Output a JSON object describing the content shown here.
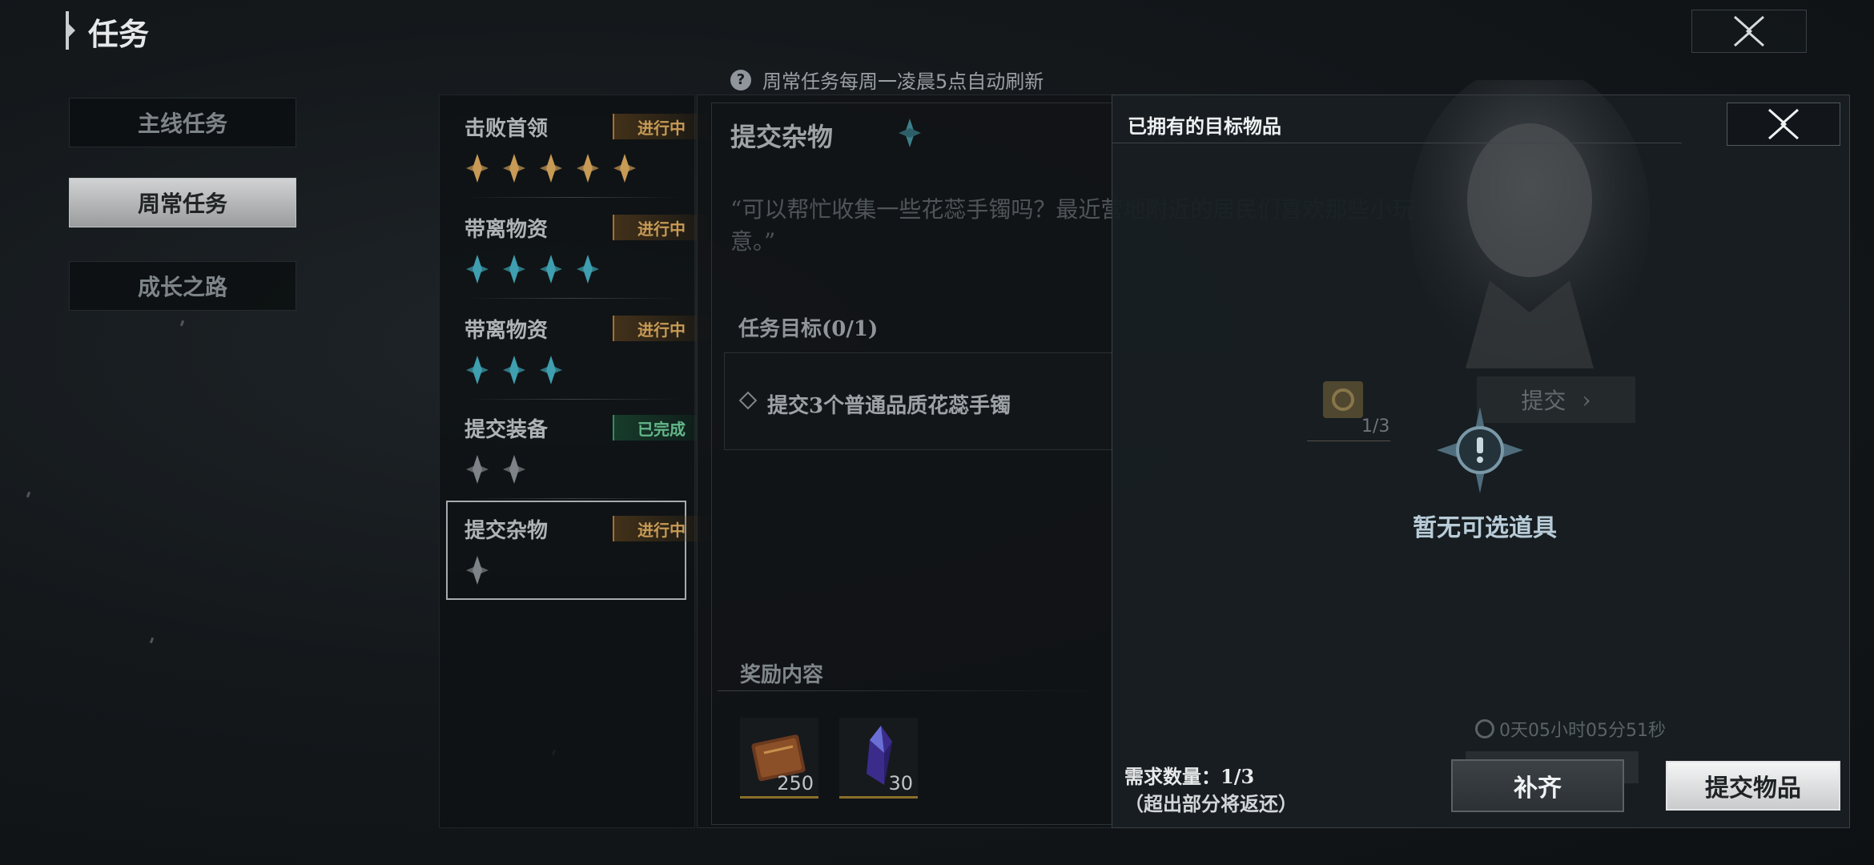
{
  "header": {
    "title": "任务"
  },
  "tabs": [
    {
      "label": "主线任务"
    },
    {
      "label": "周常任务"
    },
    {
      "label": "成长之路"
    }
  ],
  "notice": {
    "text": "周常任务每周一凌晨5点自动刷新"
  },
  "tasks": [
    {
      "name": "击败首领",
      "status": "进行中",
      "stars": 5,
      "star_color": "#c79a55"
    },
    {
      "name": "带离物资",
      "status": "进行中",
      "stars": 4,
      "star_color": "#3f9fb0"
    },
    {
      "name": "带离物资",
      "status": "进行中",
      "stars": 3,
      "star_color": "#3f9fb0"
    },
    {
      "name": "提交装备",
      "status": "已完成",
      "stars": 2,
      "star_color": "#7d8386"
    },
    {
      "name": "提交杂物",
      "status": "进行中",
      "stars": 1,
      "star_color": "#7d8386"
    }
  ],
  "detail": {
    "title": "提交杂物",
    "quote": "“可以帮忙收集一些花蕊手镯吗？最近营地附近的居民们喜欢那些小玩意。”",
    "objective_title": "任务目标(0/1)",
    "objective_text": "提交3个普通品质花蕊手镯",
    "objective_item_count": "1/3",
    "objective_submit_label": "提交",
    "reward_title": "奖励内容",
    "rewards": [
      {
        "icon": "book-icon",
        "count": "250"
      },
      {
        "icon": "crystal-icon",
        "count": "30"
      }
    ],
    "timer": "0天05小时05分51秒"
  },
  "popup": {
    "title": "已拥有的目标物品",
    "empty_text": "暂无可选道具",
    "required_label": "需求数量：1/3",
    "note": "（超出部分将返还）",
    "fill_label": "补齐",
    "submit_label": "提交物品"
  }
}
